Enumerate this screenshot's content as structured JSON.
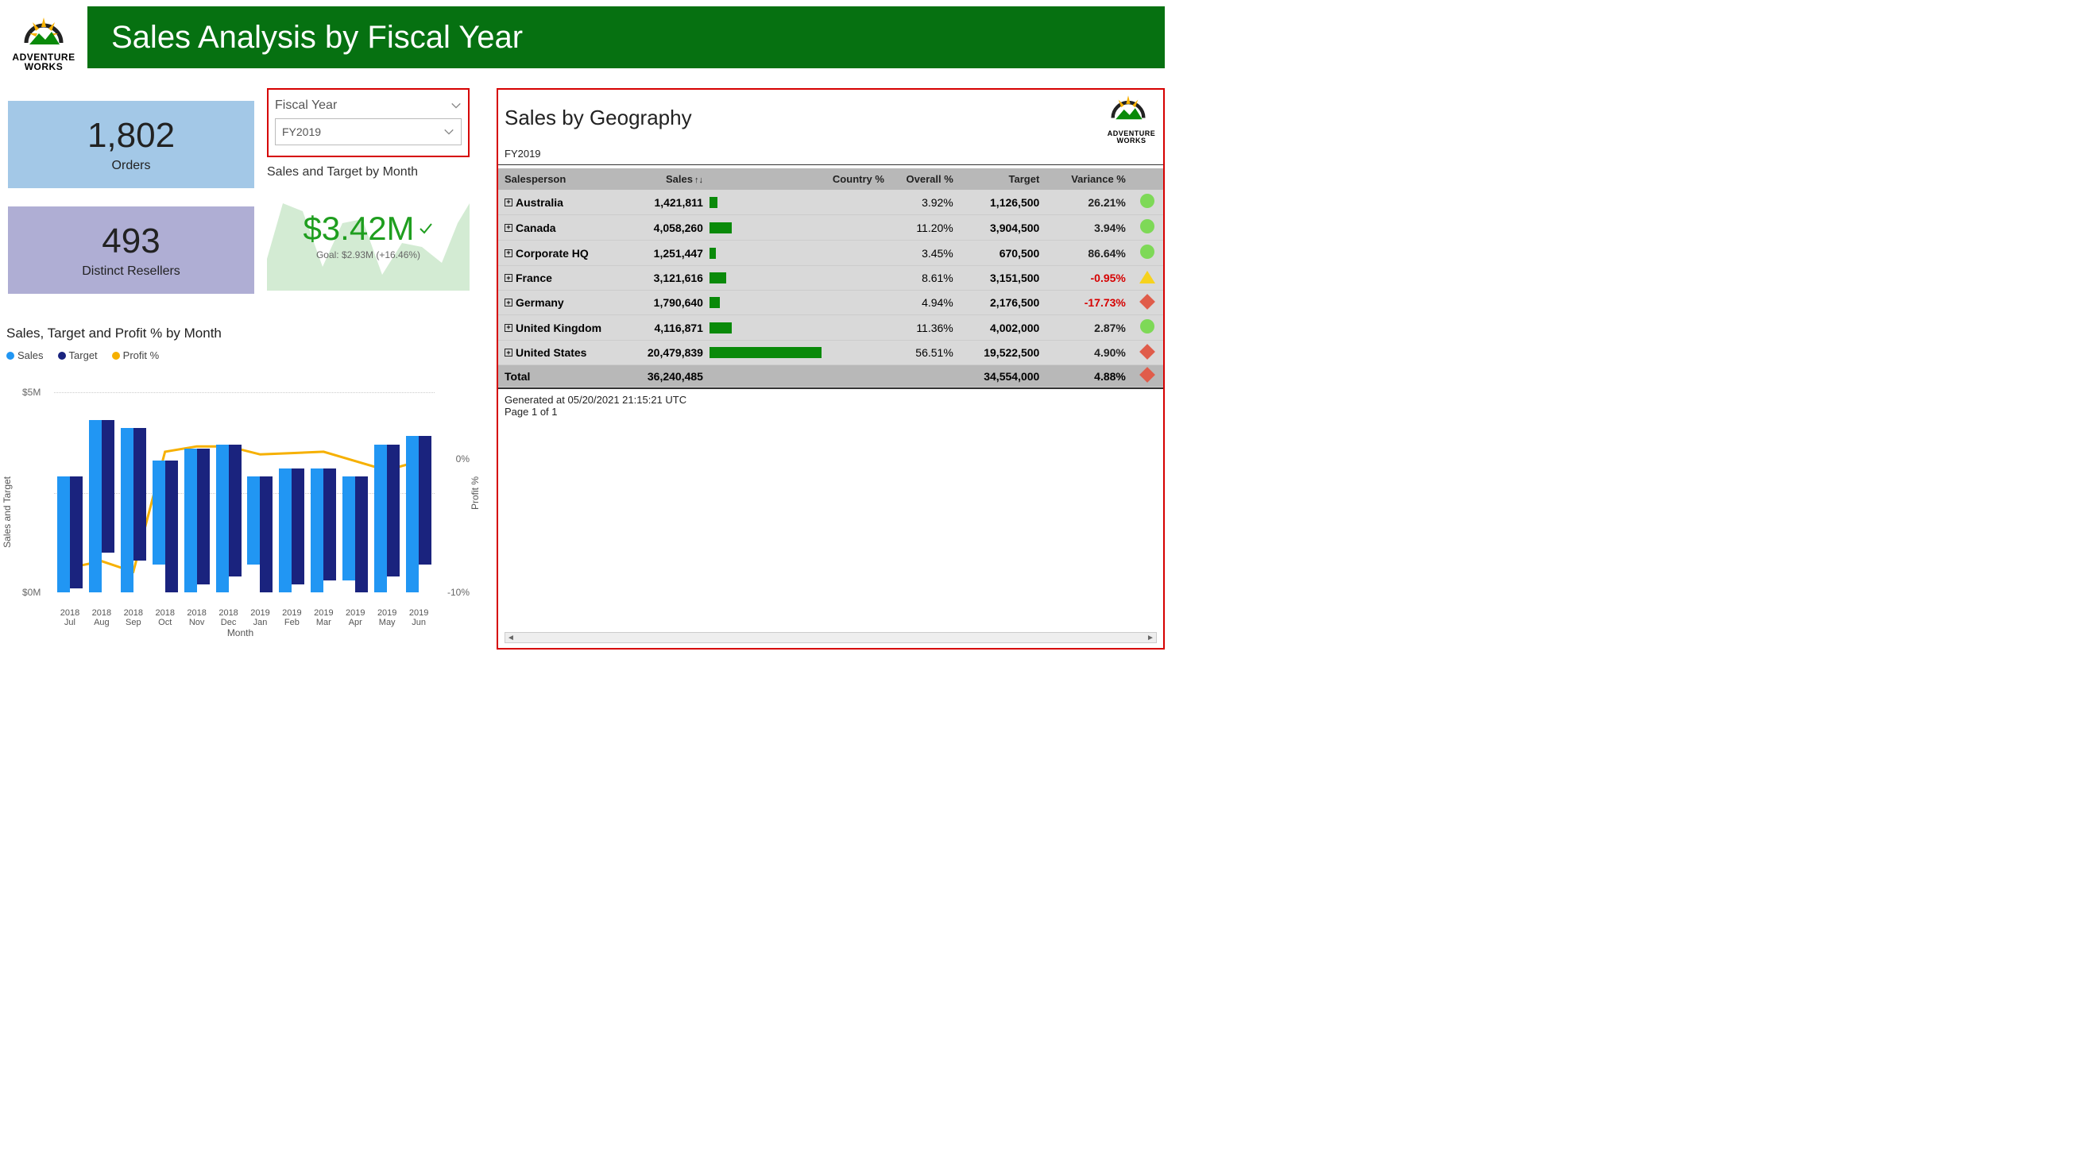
{
  "header": {
    "title": "Sales Analysis by Fiscal Year",
    "logo_line1": "ADVENTURE",
    "logo_line2": "WORKS"
  },
  "kpi": {
    "orders_value": "1,802",
    "orders_label": "Orders",
    "resellers_value": "493",
    "resellers_label": "Distinct Resellers",
    "sales_title": "Sales and Target by Month",
    "sales_value": "$3.42M",
    "sales_goal": "Goal: $2.93M (+16.46%)"
  },
  "slicer": {
    "title": "Fiscal Year",
    "selected": "FY2019"
  },
  "chart_title": "Sales, Target and Profit % by Month",
  "legend": {
    "sales": "Sales",
    "target": "Target",
    "profit": "Profit %"
  },
  "y_left": {
    "max": "$5M",
    "min": "$0M",
    "title": "Sales and Target"
  },
  "y_right": {
    "mid": "0%",
    "low": "-10%",
    "title": "Profit %"
  },
  "x_title": "Month",
  "matrix": {
    "title": "Sales by Geography",
    "subtitle": "FY2019",
    "columns": {
      "salesperson": "Salesperson",
      "sales": "Sales",
      "country": "Country %",
      "overall": "Overall %",
      "target": "Target",
      "variance": "Variance %"
    },
    "rows": [
      {
        "region": "Australia",
        "sales": "1,421,811",
        "overall": "3.92%",
        "target": "1,126,500",
        "variance": "26.21%",
        "varcls": "pos",
        "kpi": "green",
        "bar": 7
      },
      {
        "region": "Canada",
        "sales": "4,058,260",
        "overall": "11.20%",
        "target": "3,904,500",
        "variance": "3.94%",
        "varcls": "pos",
        "kpi": "green",
        "bar": 20
      },
      {
        "region": "Corporate HQ",
        "sales": "1,251,447",
        "overall": "3.45%",
        "target": "670,500",
        "variance": "86.64%",
        "varcls": "pos",
        "kpi": "green",
        "bar": 6
      },
      {
        "region": "France",
        "sales": "3,121,616",
        "overall": "8.61%",
        "target": "3,151,500",
        "variance": "-0.95%",
        "varcls": "neg",
        "kpi": "tri",
        "bar": 15
      },
      {
        "region": "Germany",
        "sales": "1,790,640",
        "overall": "4.94%",
        "target": "2,176,500",
        "variance": "-17.73%",
        "varcls": "neg",
        "kpi": "diamond",
        "bar": 9
      },
      {
        "region": "United Kingdom",
        "sales": "4,116,871",
        "overall": "11.36%",
        "target": "4,002,000",
        "variance": "2.87%",
        "varcls": "pos",
        "kpi": "green",
        "bar": 20
      },
      {
        "region": "United States",
        "sales": "20,479,839",
        "overall": "56.51%",
        "target": "19,522,500",
        "variance": "4.90%",
        "varcls": "pos",
        "kpi": "diamond",
        "bar": 100
      }
    ],
    "total": {
      "region": "Total",
      "sales": "36,240,485",
      "target": "34,554,000",
      "variance": "4.88%",
      "kpi": "diamond"
    },
    "footer_line1": "Generated at 05/20/2021 21:15:21 UTC",
    "footer_line2": "Page 1 of 1"
  },
  "chart_data": {
    "type": "bar-line-combo",
    "title": "Sales, Target and Profit % by Month",
    "categories": [
      "2018 Jul",
      "2018 Aug",
      "2018 Sep",
      "2018 Oct",
      "2018 Nov",
      "2018 Dec",
      "2019 Jan",
      "2019 Feb",
      "2019 Mar",
      "2019 Apr",
      "2019 May",
      "2019 Jun"
    ],
    "series": [
      {
        "name": "Sales",
        "type": "bar",
        "color": "#2196f3",
        "values": [
          2.9,
          4.3,
          4.1,
          2.6,
          3.6,
          3.7,
          2.2,
          3.1,
          3.1,
          2.6,
          3.7,
          3.9
        ]
      },
      {
        "name": "Target",
        "type": "bar",
        "color": "#1a237e",
        "values": [
          2.8,
          3.3,
          3.3,
          3.3,
          3.4,
          3.3,
          2.9,
          2.9,
          2.8,
          2.9,
          3.3,
          3.2
        ]
      },
      {
        "name": "Profit %",
        "type": "line",
        "color": "#f6b000",
        "values": [
          -8.1,
          -7.6,
          -8.4,
          0.6,
          1.0,
          1.0,
          0.4,
          0.5,
          0.6,
          -0.1,
          -0.8,
          -0.1
        ]
      }
    ],
    "y_left": {
      "label": "Sales and Target",
      "min": 0,
      "max": 5,
      "unit": "$M"
    },
    "y_right": {
      "label": "Profit %",
      "min": -10,
      "max": 5,
      "unit": "%"
    },
    "xlabel": "Month"
  }
}
